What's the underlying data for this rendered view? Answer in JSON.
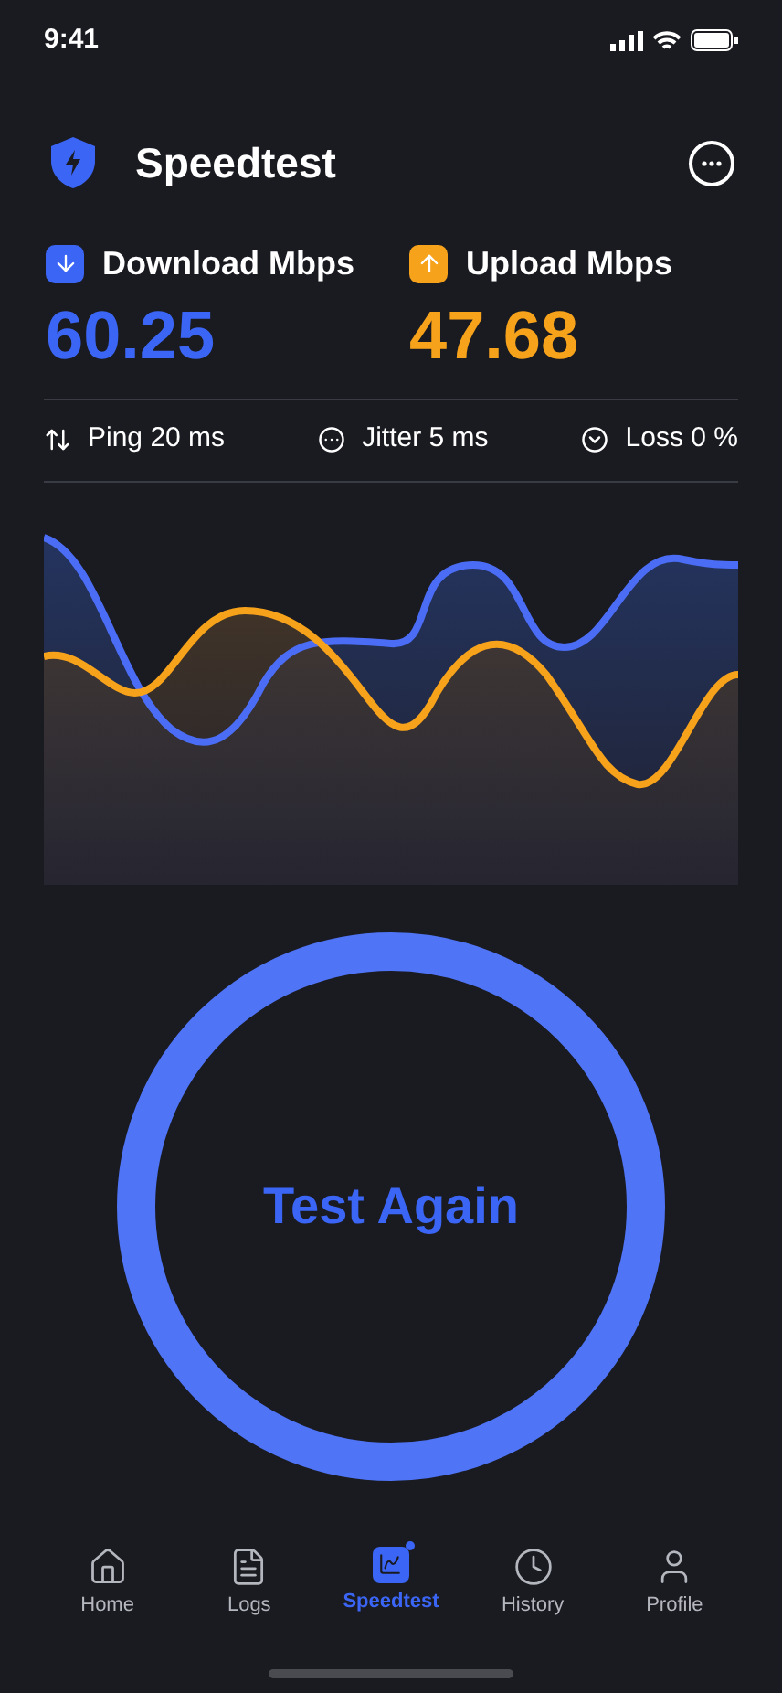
{
  "status_bar": {
    "time": "9:41"
  },
  "header": {
    "title": "Speedtest"
  },
  "metrics": [
    {
      "kind": "download",
      "label": "Download Mbps",
      "value": "60.25"
    },
    {
      "kind": "upload",
      "label": "Upload Mbps",
      "value": "47.68"
    }
  ],
  "stats": [
    {
      "kind": "ping",
      "label": "Ping 20 ms"
    },
    {
      "kind": "jitter",
      "label": "Jitter 5 ms"
    },
    {
      "kind": "loss",
      "label": "Loss 0 %"
    }
  ],
  "action": {
    "label": "Test Again"
  },
  "tabs": [
    {
      "kind": "home",
      "label": "Home",
      "selected": false
    },
    {
      "kind": "logs",
      "label": "Logs",
      "selected": false
    },
    {
      "kind": "speedtest",
      "label": "Speedtest",
      "selected": true
    },
    {
      "kind": "history",
      "label": "History",
      "selected": false
    },
    {
      "kind": "profile",
      "label": "Profile",
      "selected": false
    }
  ]
}
